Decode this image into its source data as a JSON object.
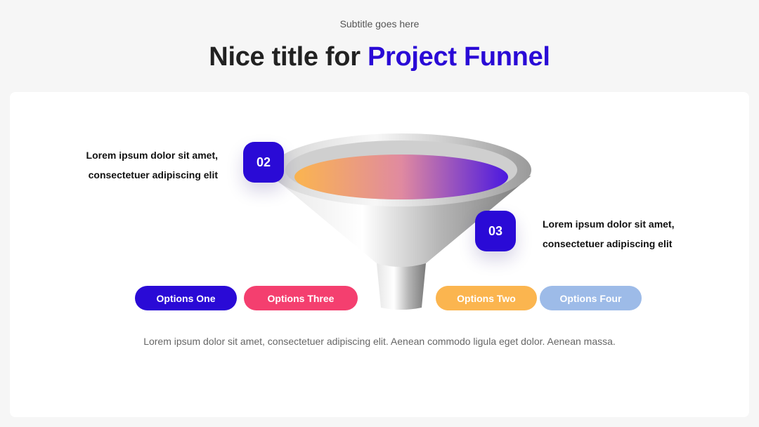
{
  "header": {
    "subtitle": "Subtitle goes here",
    "title_plain": "Nice title for",
    "title_accent": "Project Funnel"
  },
  "steps": [
    {
      "number": "02",
      "text_line1": "Lorem ipsum dolor sit amet,",
      "text_line2": "consectetuer adipiscing elit"
    },
    {
      "number": "03",
      "text_line1": "Lorem ipsum dolor sit amet,",
      "text_line2": "consectetuer adipiscing elit"
    }
  ],
  "options": [
    {
      "label": "Options One",
      "color": "#2a0ad6"
    },
    {
      "label": "Options Three",
      "color": "#f43f6f"
    },
    {
      "label": "Options Two",
      "color": "#fbb54f"
    },
    {
      "label": "Options Four",
      "color": "#9dbbe8"
    }
  ],
  "description": "Lorem ipsum dolor sit amet, consectetuer adipiscing elit. Aenean commodo ligula eget dolor. Aenean massa.",
  "colors": {
    "accent": "#2a0ad6",
    "funnel_gradient": [
      "#fbb54f",
      "#f43f6f",
      "#2a0ad6"
    ]
  }
}
